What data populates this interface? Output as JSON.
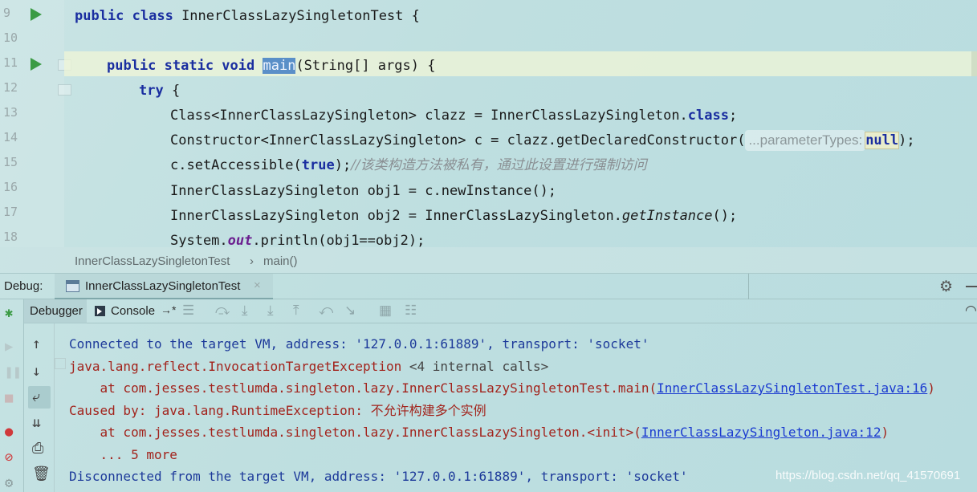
{
  "editor": {
    "line_numbers": [
      "9",
      "10",
      "11",
      "12",
      "13",
      "14",
      "15",
      "16",
      "17",
      "18"
    ],
    "line9": {
      "kw": "public class",
      "rest": " InnerClassLazySingletonTest {"
    },
    "line11": {
      "kw": "public static void",
      "sel": "main",
      "rest": "(String[] args) {"
    },
    "line12": {
      "kw": "try",
      "rest": " {"
    },
    "line13": {
      "a": "Class<InnerClassLazySingleton> clazz = InnerClassLazySingleton.",
      "kw": "class",
      "b": ";"
    },
    "line14": {
      "a": "Constructor<InnerClassLazySingleton> c = clazz.getDeclaredConstructor(",
      "hint": "...parameterTypes:",
      "kw": "null",
      "b": ");"
    },
    "line15": {
      "a": "c.setAccessible(",
      "kw": "true",
      "b": ");",
      "comment": "//该类构造方法被私有，通过此设置进行强制访问"
    },
    "line16": {
      "a": "InnerClassLazySingleton obj1 = c.newInstance();"
    },
    "line17": {
      "a": "InnerClassLazySingleton obj2 = InnerClassLazySingleton.",
      "it": "getInstance",
      "b": "();"
    },
    "line18": {
      "a": "System.",
      "fld": "out",
      "b": ".println(obj1==obj2);"
    }
  },
  "breadcrumb": {
    "class": "InnerClassLazySingletonTest",
    "sep": "›",
    "method": "main()"
  },
  "debug": {
    "label": "Debug:",
    "tab_title": "InnerClassLazySingletonTest",
    "tab_close": "×"
  },
  "toolbar": {
    "debugger": "Debugger",
    "console": "Console",
    "pin": "→*"
  },
  "console": {
    "line1": "Connected to the target VM, address: '127.0.0.1:61889', transport: 'socket'",
    "line2a": "java.lang.reflect.InvocationTargetException ",
    "line2b": "<4 internal calls>",
    "line3a": "    at com.jesses.testlumda.singleton.lazy.InnerClassLazySingletonTest.main(",
    "line3link": "InnerClassLazySingletonTest.java:16",
    "line3b": ")",
    "line4": "Caused by: java.lang.RuntimeException: 不允许构建多个实例",
    "line5a": "    at com.jesses.testlumda.singleton.lazy.InnerClassLazySingleton.<init>(",
    "line5link": "InnerClassLazySingleton.java:12",
    "line5b": ")",
    "line6": "    ... 5 more",
    "line7": "Disconnected from the target VM, address: '127.0.0.1:61889', transport: 'socket'"
  },
  "watermark": "https://blog.csdn.net/qq_41570691"
}
